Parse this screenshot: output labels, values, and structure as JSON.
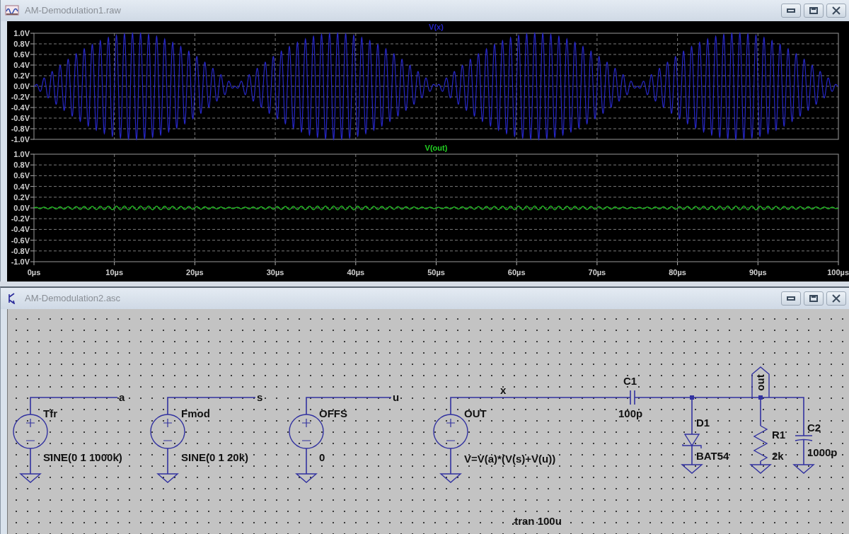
{
  "waveform_window": {
    "title": "AM-Demodulation1.raw",
    "panes": [
      {
        "trace": "V(x)",
        "kind": "modulated",
        "color": "#2626c8",
        "y_ticks": [
          "1.0V",
          "0.8V",
          "0.6V",
          "0.4V",
          "0.2V",
          "0.0V",
          "-0.2V",
          "-0.4V",
          "-0.6V",
          "-0.8V",
          "-1.0V"
        ]
      },
      {
        "trace": "V(out)",
        "kind": "demodulated",
        "color": "#22d022",
        "y_ticks": [
          "1.0V",
          "0.8V",
          "0.6V",
          "0.4V",
          "0.2V",
          "0.0V",
          "-0.2V",
          "-0.4V",
          "-0.6V",
          "-0.8V",
          "-1.0V"
        ]
      }
    ],
    "x_ticks": [
      "0µs",
      "10µs",
      "20µs",
      "30µs",
      "40µs",
      "50µs",
      "60µs",
      "70µs",
      "80µs",
      "90µs",
      "100µs"
    ]
  },
  "schematic_window": {
    "title": "AM-Demodulation2.asc",
    "components": [
      {
        "kind": "voltage_source",
        "name": "Tfr",
        "value": "SINE(0 1 1000k)"
      },
      {
        "kind": "voltage_source",
        "name": "Fmod",
        "value": "SINE(0 1 20k)"
      },
      {
        "kind": "voltage_source",
        "name": "OFFS",
        "value": "0"
      },
      {
        "kind": "voltage_source",
        "name": "OUT",
        "value": "V=V(a)*(V(s)+V(u))"
      },
      {
        "kind": "capacitor",
        "name": "C1",
        "value": "100p"
      },
      {
        "kind": "diode",
        "name": "D1",
        "value": "BAT54"
      },
      {
        "kind": "resistor",
        "name": "R1",
        "value": "2k"
      },
      {
        "kind": "capacitor",
        "name": "C2",
        "value": "1000p"
      }
    ],
    "net_labels": [
      "a",
      "s",
      "u",
      "x"
    ],
    "port_label": "out",
    "directive": ".tran 100u"
  }
}
